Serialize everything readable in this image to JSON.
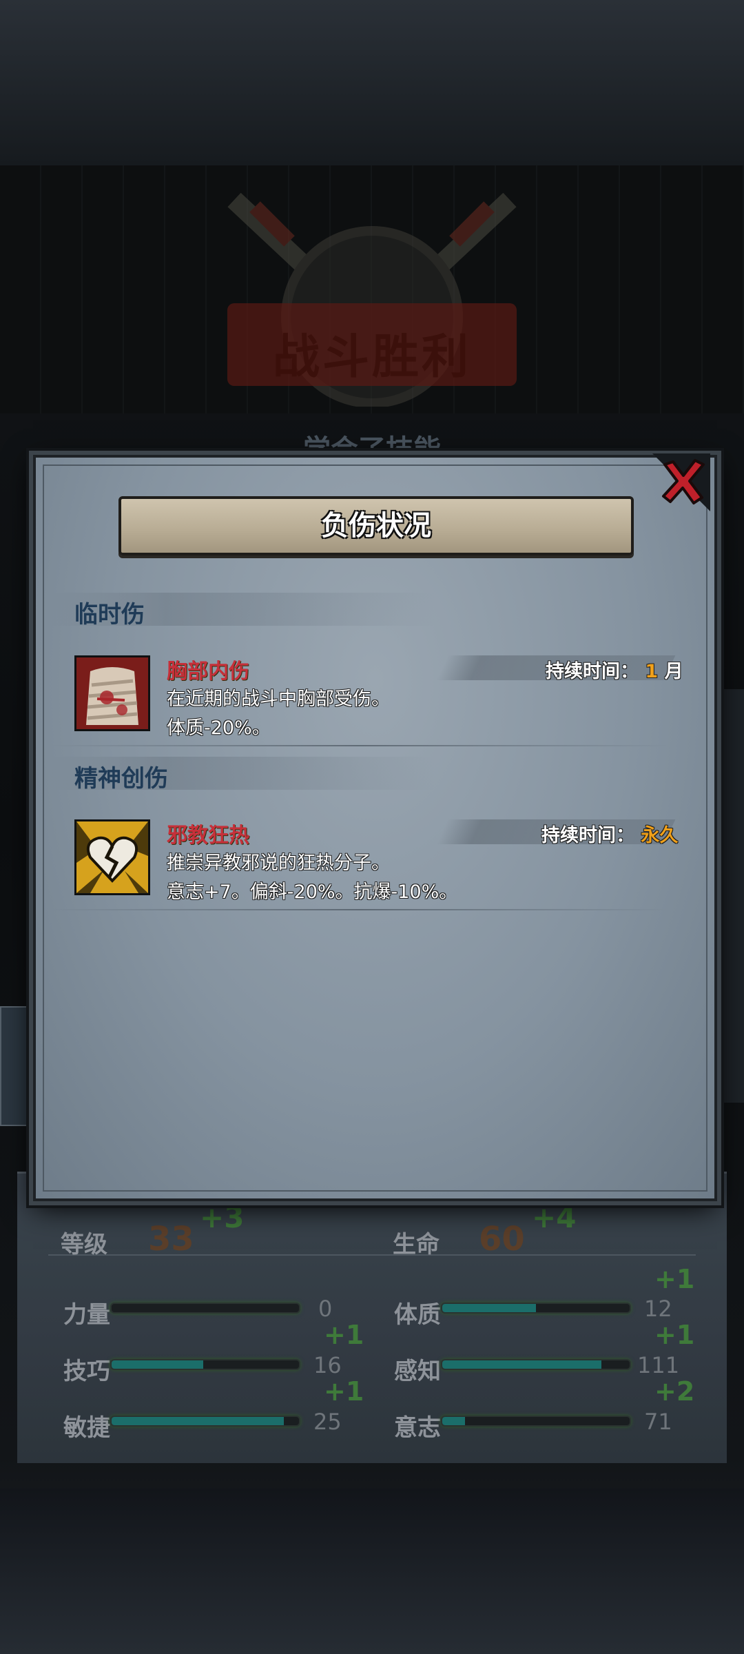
{
  "background": {
    "victory_title": "战斗胜利",
    "learned_skill_text": "学会了技能"
  },
  "modal": {
    "title": "负伤状况",
    "close_icon": "close-x-icon",
    "sections": [
      {
        "title": "临时伤",
        "items": [
          {
            "icon": "bandaged-chest-icon",
            "name": "胸部内伤",
            "desc_line1": "在近期的战斗中胸部受伤。",
            "desc_line2": "体质-20%。",
            "duration_label": "持续时间：",
            "duration_number": "1",
            "duration_unit": "月"
          }
        ]
      },
      {
        "title": "精神创伤",
        "items": [
          {
            "icon": "broken-heart-icon",
            "name": "邪教狂热",
            "desc_line1": "推崇异教邪说的狂热分子。",
            "desc_line2": "意志+7。偏斜-20%。抗爆-10%。",
            "duration_label": "持续时间：",
            "duration_value": "永久"
          }
        ]
      }
    ]
  },
  "stats": {
    "level": {
      "label": "等级",
      "value": "33",
      "plus": "+3"
    },
    "life": {
      "label": "生命",
      "value": "60",
      "plus": "+4"
    },
    "strength": {
      "label": "力量",
      "value": "0",
      "fill": 0.0
    },
    "constitution": {
      "label": "体质",
      "value": "12",
      "plus": "+1",
      "fill": 0.5
    },
    "skill": {
      "label": "技巧",
      "value": "16",
      "plus": "+1",
      "fill": 0.49
    },
    "perception": {
      "label": "感知",
      "value": "111",
      "plus": "+1",
      "fill": 0.85
    },
    "agility": {
      "label": "敏捷",
      "value": "25",
      "plus": "+1",
      "fill": 0.92
    },
    "will": {
      "label": "意志",
      "value": "71",
      "plus": "+2",
      "fill": 0.12
    },
    "accent_green": "#3f7a3a",
    "bar_teal": "#1b6e6a"
  },
  "colors": {
    "injury_name": "#c6303a",
    "duration_value": "#f0a019",
    "section_title": "#1f3b57"
  }
}
